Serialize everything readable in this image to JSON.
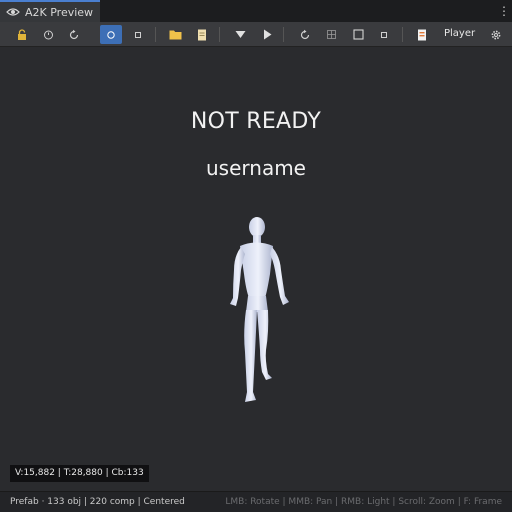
{
  "tab": {
    "title": "A2K Preview",
    "icon": "eye-icon",
    "accent": "#4a7fd0"
  },
  "menu": {
    "kebab": "⋮"
  },
  "toolbar": {
    "active_color": "#3d6fb6",
    "player_label": "Player"
  },
  "viewport": {
    "status": "NOT READY",
    "username": "username",
    "stats": "V:15,882 | T:28,880 | Cb:133"
  },
  "statusbar": {
    "left": "Prefab · 133 obj | 220 comp | Centered",
    "right": "LMB: Rotate | MMB: Pan | RMB: Light | Scroll: Zoom | F: Frame"
  }
}
